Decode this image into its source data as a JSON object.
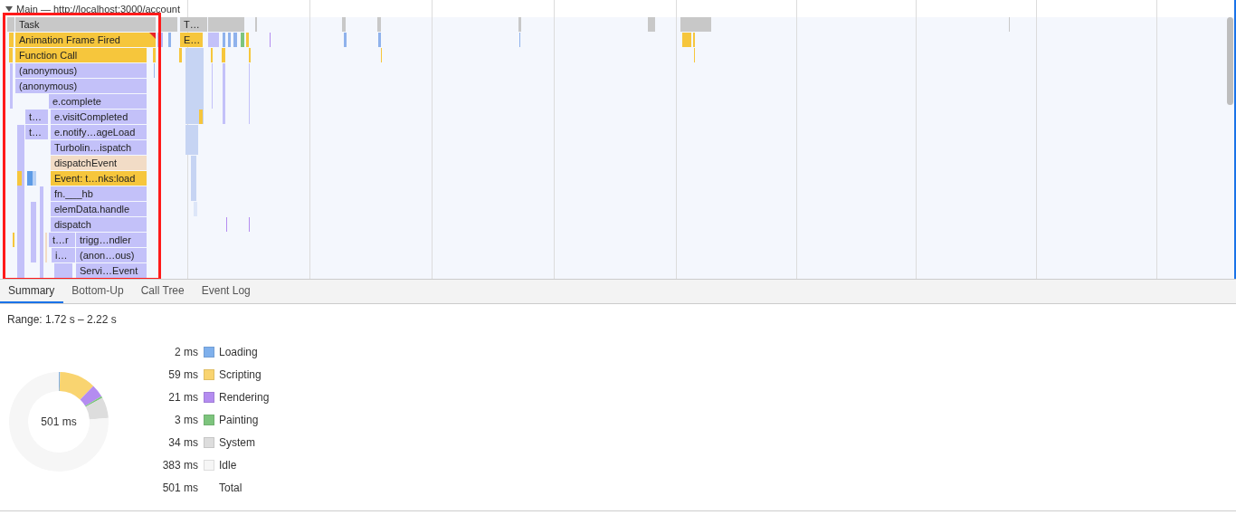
{
  "timeline": {
    "track_title": "Main — http://localhost:3000/account",
    "expanded": true,
    "flame_rows": [
      [
        {
          "label": "Task",
          "kind": "system",
          "warning": false
        },
        {
          "label": "T…",
          "kind": "system",
          "warning": false
        }
      ],
      [
        {
          "label": "Animation Frame Fired",
          "kind": "scripting",
          "warning": true
        },
        {
          "label": "E…",
          "kind": "scripting",
          "warning": false
        }
      ],
      [
        {
          "label": "Function Call",
          "kind": "scripting",
          "warning": false
        }
      ],
      [
        {
          "label": "(anonymous)",
          "kind": "function",
          "warning": false
        }
      ],
      [
        {
          "label": "(anonymous)",
          "kind": "function",
          "warning": false
        }
      ],
      [
        {
          "label": "e.complete",
          "kind": "function",
          "warning": false
        }
      ],
      [
        {
          "label": "t…",
          "kind": "function",
          "warning": false
        },
        {
          "label": "e.visitCompleted",
          "kind": "function",
          "warning": false
        }
      ],
      [
        {
          "label": "t…",
          "kind": "function",
          "warning": false
        },
        {
          "label": "e.notify…ageLoad",
          "kind": "function",
          "warning": false
        }
      ],
      [
        {
          "label": "Turbolin…ispatch",
          "kind": "function",
          "warning": false
        }
      ],
      [
        {
          "label": "dispatchEvent",
          "kind": "event",
          "warning": false
        }
      ],
      [
        {
          "label": "Event: t…nks:load",
          "kind": "scripting",
          "warning": false
        }
      ],
      [
        {
          "label": "fn.___hb",
          "kind": "function",
          "warning": false
        }
      ],
      [
        {
          "label": "elemData.handle",
          "kind": "function",
          "warning": false
        }
      ],
      [
        {
          "label": "dispatch",
          "kind": "function",
          "warning": false
        }
      ],
      [
        {
          "label": "t…r",
          "kind": "function",
          "warning": false
        },
        {
          "label": "trigg…ndler",
          "kind": "function",
          "warning": false
        }
      ],
      [
        {
          "label": "i…",
          "kind": "function",
          "warning": false
        },
        {
          "label": "(anon…ous)",
          "kind": "function",
          "warning": false
        }
      ],
      [
        {
          "label": "Servi…Event",
          "kind": "function",
          "warning": false
        }
      ]
    ]
  },
  "tabs": [
    {
      "label": "Summary",
      "selected": true
    },
    {
      "label": "Bottom-Up",
      "selected": false
    },
    {
      "label": "Call Tree",
      "selected": false
    },
    {
      "label": "Event Log",
      "selected": false
    }
  ],
  "summary": {
    "range": "Range: 1.72 s – 2.22 s",
    "total_label": "501 ms",
    "chart_data": {
      "type": "donut",
      "categories": [
        "Loading",
        "Scripting",
        "Rendering",
        "Painting",
        "System",
        "Idle"
      ],
      "series": [
        {
          "values": [
            0.4,
            11.8,
            4.2,
            0.6,
            6.8,
            76.2
          ]
        }
      ]
    },
    "legend": [
      {
        "value": "2 ms",
        "color": "#7fb0ec"
      },
      {
        "value": "59 ms",
        "color": "#f9d470"
      },
      {
        "value": "21 ms",
        "color": "#b48cf0"
      },
      {
        "value": "3 ms",
        "color": "#7dc47d"
      },
      {
        "value": "34 ms",
        "color": "#dddddd"
      },
      {
        "value": "383 ms",
        "color": "#f6f6f6"
      }
    ],
    "total_row": {
      "value": "501 ms",
      "label": "Total"
    }
  }
}
